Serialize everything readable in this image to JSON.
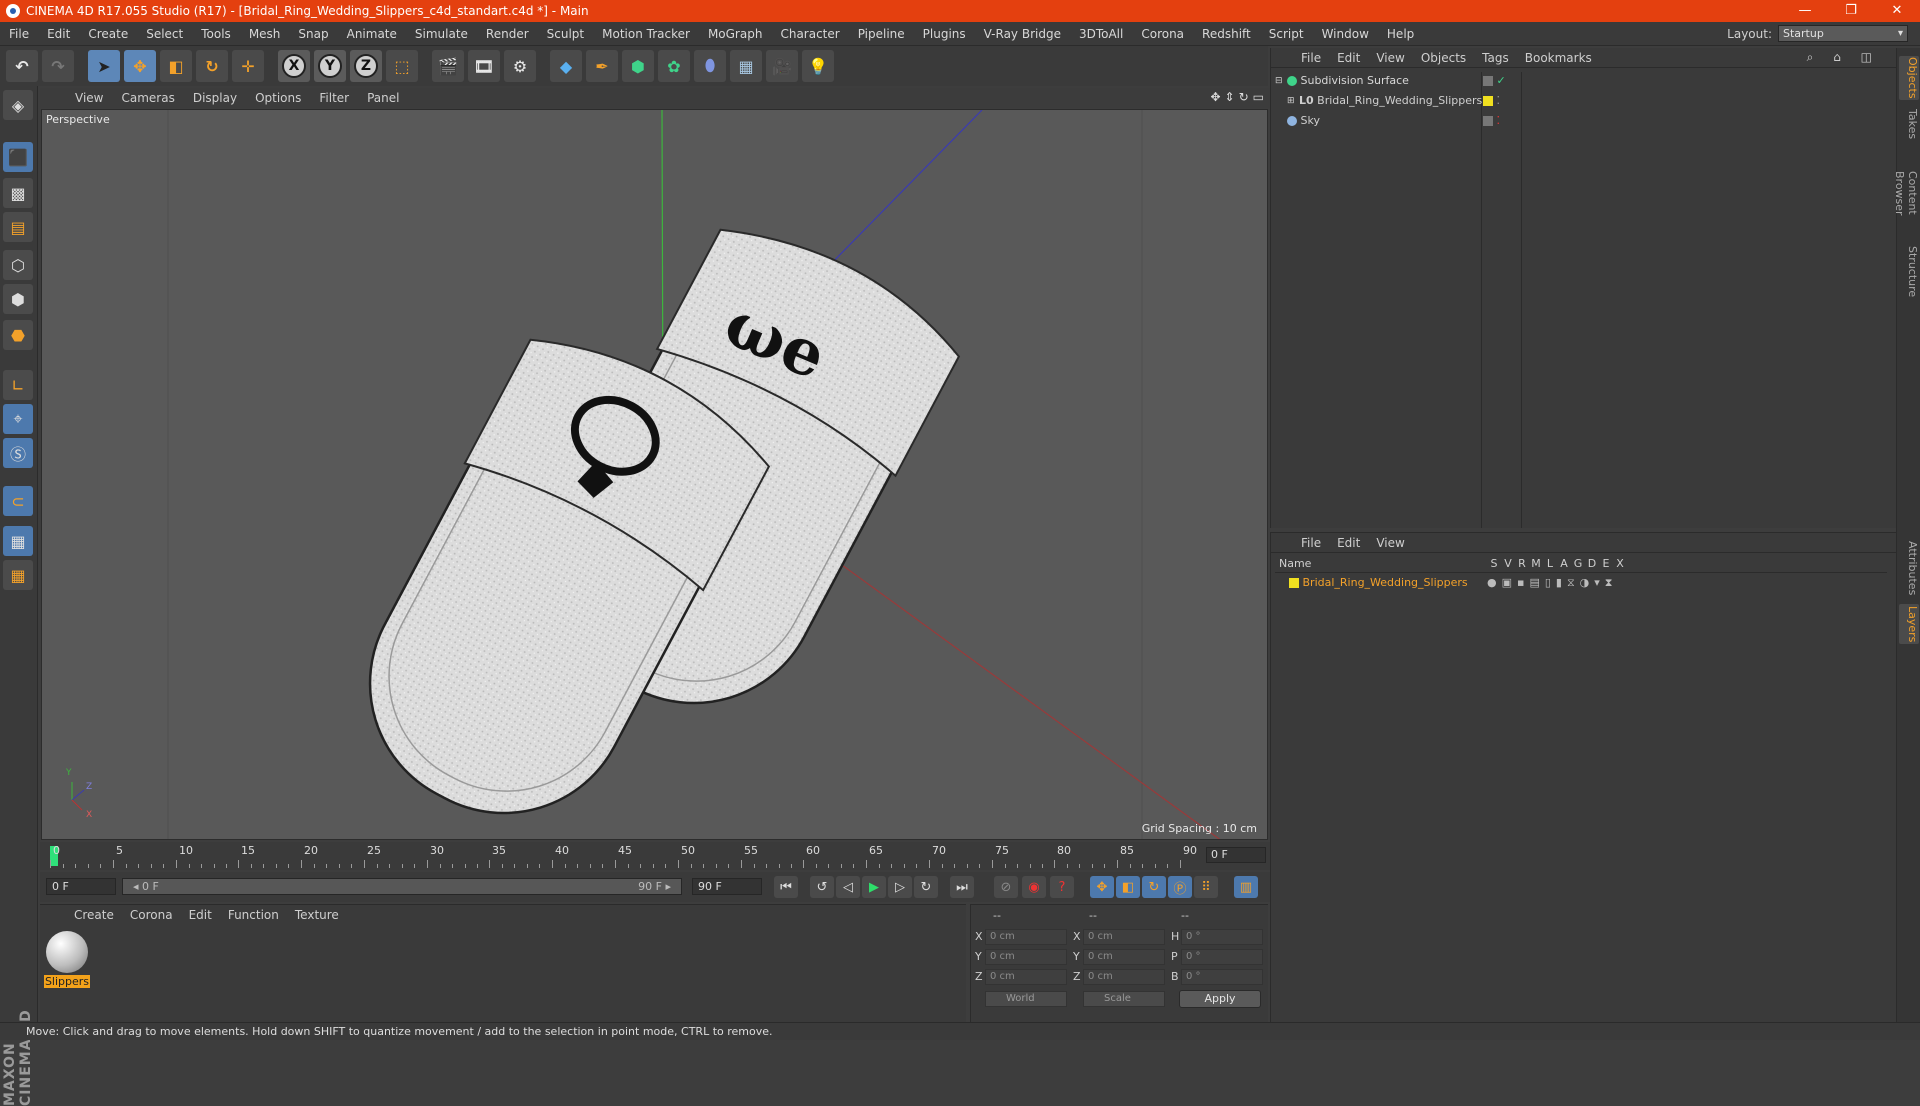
{
  "window": {
    "title": "CINEMA 4D R17.055 Studio (R17) - [Bridal_Ring_Wedding_Slippers_c4d_standart.c4d *] - Main",
    "controls": [
      "—",
      "❐",
      "✕"
    ]
  },
  "menu": [
    "File",
    "Edit",
    "Create",
    "Select",
    "Tools",
    "Mesh",
    "Snap",
    "Animate",
    "Simulate",
    "Render",
    "Sculpt",
    "Motion Tracker",
    "MoGraph",
    "Character",
    "Pipeline",
    "Plugins",
    "V-Ray Bridge",
    "3DToAll",
    "Corona",
    "Redshift",
    "Script",
    "Window",
    "Help"
  ],
  "layout": {
    "label": "Layout:",
    "value": "Startup"
  },
  "toolbar": {
    "axis_x": "X",
    "axis_y": "Y",
    "axis_z": "Z"
  },
  "viewport": {
    "menu": [
      "View",
      "Cameras",
      "Display",
      "Options",
      "Filter",
      "Panel"
    ],
    "camera_label": "Perspective",
    "grid_spacing": "Grid Spacing : 10 cm",
    "axis_labels": {
      "y": "Y",
      "z": "Z",
      "x": "X"
    }
  },
  "timeline": {
    "ticks": [
      "0",
      "5",
      "10",
      "15",
      "20",
      "25",
      "30",
      "35",
      "40",
      "45",
      "50",
      "55",
      "60",
      "65",
      "70",
      "75",
      "80",
      "85",
      "90"
    ],
    "end_frame": "0 F",
    "current": "0 F",
    "range_start": "◂ 0 F",
    "range_end": "90 F ▸",
    "max": "90 F"
  },
  "material_panel": {
    "menu": [
      "Create",
      "Corona",
      "Edit",
      "Function",
      "Texture"
    ],
    "material_name": "Slippers"
  },
  "coords": {
    "headers": [
      "--",
      "--",
      "--"
    ],
    "rows": [
      {
        "a": "X",
        "av": "0 cm",
        "b": "X",
        "bv": "0 cm",
        "c": "H",
        "cv": "0 °"
      },
      {
        "a": "Y",
        "av": "0 cm",
        "b": "Y",
        "bv": "0 cm",
        "c": "P",
        "cv": "0 °"
      },
      {
        "a": "Z",
        "av": "0 cm",
        "b": "Z",
        "bv": "0 cm",
        "c": "B",
        "cv": "0 °"
      }
    ],
    "world": "World",
    "scale": "Scale",
    "apply": "Apply"
  },
  "object_manager": {
    "menu": [
      "File",
      "Edit",
      "View",
      "Objects",
      "Tags",
      "Bookmarks"
    ],
    "objects": [
      {
        "name": "Subdivision Surface",
        "color": "#8fe08f"
      },
      {
        "name": "Bridal_Ring_Wedding_Slippers",
        "color": "#cfcfcf"
      },
      {
        "name": "Sky",
        "color": "#cfcfcf"
      }
    ]
  },
  "layer_manager": {
    "menu": [
      "File",
      "Edit",
      "View"
    ],
    "columns": [
      "Name",
      "S",
      "V",
      "R",
      "M",
      "L",
      "A",
      "G",
      "D",
      "E",
      "X"
    ],
    "layer_name": "Bridal_Ring_Wedding_Slippers"
  },
  "right_tabs": [
    "Objects",
    "Takes",
    "Content Browser",
    "Structure",
    "Attributes",
    "Layers"
  ],
  "status": "Move: Click and drag to move elements. Hold down SHIFT to quantize movement / add to the selection in point mode, CTRL to remove.",
  "logo": "MAXON CINEMA 4D",
  "colors": {
    "titlebar": "#e4400f",
    "accent": "#f3a12a",
    "active_tool": "#5d87b8"
  }
}
